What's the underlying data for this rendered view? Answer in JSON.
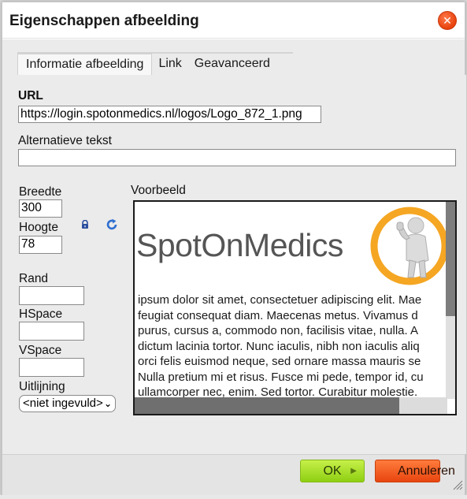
{
  "dialog": {
    "title": "Eigenschappen afbeelding",
    "close_icon": "close-icon"
  },
  "tabs": [
    {
      "label": "Informatie afbeelding",
      "active": true
    },
    {
      "label": "Link",
      "active": false
    },
    {
      "label": "Geavanceerd",
      "active": false
    }
  ],
  "form": {
    "url_label": "URL",
    "url_value": "https://login.spotonmedics.nl/logos/Logo_872_1.png",
    "alt_label": "Alternatieve tekst",
    "alt_value": "",
    "width_label": "Breedte",
    "width_value": "300",
    "height_label": "Hoogte",
    "height_value": "78",
    "lock_icon": "lock-icon",
    "reset_icon": "reset-size-icon",
    "border_label": "Rand",
    "border_value": "",
    "hspace_label": "HSpace",
    "hspace_value": "",
    "vspace_label": "VSpace",
    "vspace_value": "",
    "align_label": "Uitlijning",
    "align_value": "<niet ingevuld>"
  },
  "preview": {
    "label": "Voorbeeld",
    "logo_text": "SpotOnMedics",
    "lines": [
      "ipsum dolor sit amet, consectetuer adipiscing elit. Mae",
      "feugiat consequat diam. Maecenas metus. Vivamus d",
      "purus, cursus a, commodo non, facilisis vitae, nulla. A",
      "dictum lacinia tortor. Nunc iaculis, nibh non iaculis aliq",
      "orci felis euismod neque, sed ornare massa mauris se",
      "Nulla pretium mi et risus. Fusce mi pede, tempor id, cu",
      "ullamcorper nec, enim. Sed tortor. Curabitur molestie."
    ]
  },
  "footer": {
    "ok_label": "OK",
    "cancel_label": "Annuleren"
  },
  "colors": {
    "ok_button": "#9bd51a",
    "cancel_button": "#f2581d",
    "close_button": "#e8420d",
    "logo_ring": "#f5a623"
  }
}
